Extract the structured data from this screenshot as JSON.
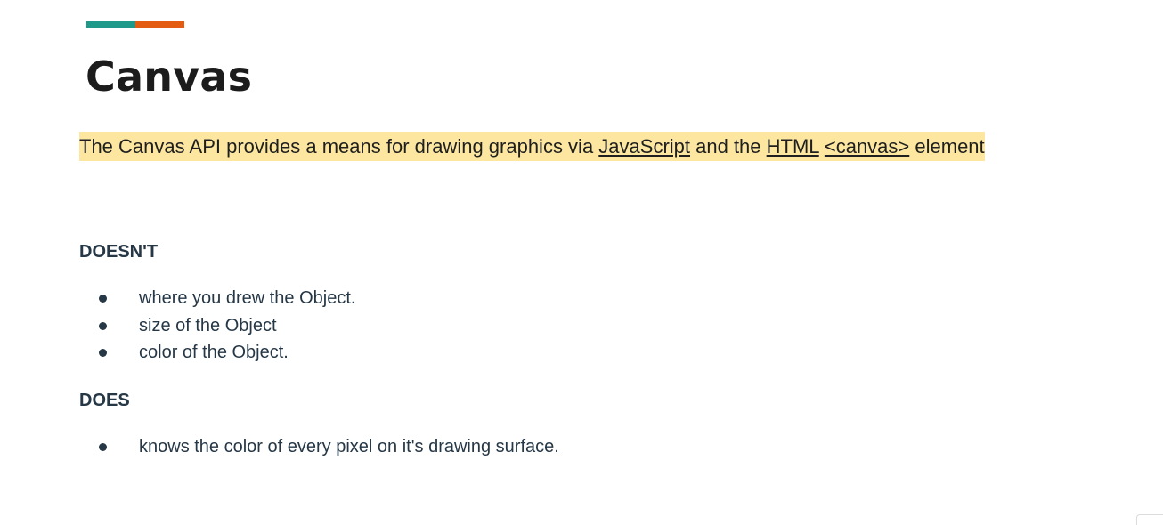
{
  "colors": {
    "accent_teal": "#1f9a8a",
    "accent_orange": "#e35c12",
    "highlight": "#fde7a0"
  },
  "slide": {
    "title": "Canvas",
    "intro": {
      "text_1": "The Canvas API provides a means for drawing graphics via ",
      "link_javascript": "JavaScript",
      "text_2": " and the ",
      "link_html": "HTML",
      "text_3": " ",
      "link_canvas": "<canvas>",
      "text_4": " element"
    },
    "doesnt": {
      "heading": "DOESN'T",
      "items": [
        "where you drew the Object.",
        "size of the Object",
        "color of the Object."
      ]
    },
    "does": {
      "heading": "DOES",
      "items": [
        "knows the color of every pixel on it's drawing surface."
      ]
    }
  }
}
